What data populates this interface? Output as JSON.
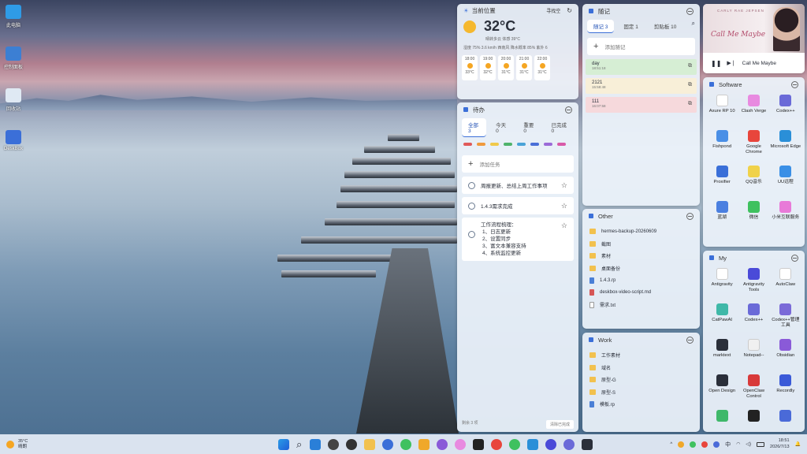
{
  "desktop": {
    "icons": [
      {
        "label": "此电脑",
        "color": "#2f9be6"
      },
      {
        "label": "控制面板",
        "color": "#3c7fd3"
      },
      {
        "label": "回收站",
        "color": "#dfe9f3"
      },
      {
        "label": "DeskBox",
        "color": "#3b6fd8"
      }
    ]
  },
  "weather": {
    "location": "当前位置",
    "refresh_label": "寻找空",
    "temp": "32°C",
    "desc": "晴转多云 体感 39°C",
    "details": "湿度 75%  3.6 km/h 西南风  降水概率 85%  紫外 6",
    "hours": [
      {
        "time": "18:00",
        "temp": "33°C"
      },
      {
        "time": "19:00",
        "temp": "32°C"
      },
      {
        "time": "20:00",
        "temp": "31°C"
      },
      {
        "time": "21:00",
        "temp": "31°C"
      },
      {
        "time": "22:00",
        "temp": "31°C"
      }
    ]
  },
  "todo": {
    "title": "待办",
    "tabs": [
      "全部 3",
      "今天 0",
      "重要 0",
      "已完成 0"
    ],
    "add_placeholder": "添加任务",
    "colors": [
      "#e05a5a",
      "#f09a3e",
      "#f0c94a",
      "#4fb36b",
      "#4aa3d8",
      "#4a6fd8",
      "#9b6ad8",
      "#d85aa8"
    ],
    "items": [
      "周报更新、总结上周工作事项",
      "1.4.3需求完成"
    ],
    "multi": [
      "工作流程梳理：",
      "1、日志更新",
      "2、设置同步",
      "3、富文本兼容支持",
      "4、系统监控更新"
    ],
    "footer_left": "剩余 3 项",
    "footer_right": "清除已完成"
  },
  "notes": {
    "title": "随记",
    "tabs": [
      "随记 3",
      "固定 1",
      "剪贴板 10"
    ],
    "add_placeholder": "添加随记",
    "items": [
      {
        "text": "day",
        "time": "18:51:18",
        "bg": "#d6eed4"
      },
      {
        "text": "2121",
        "time": "15:58:48",
        "bg": "#f8efd8"
      },
      {
        "text": "111",
        "time": "16:07:58",
        "bg": "#f6d9dc"
      }
    ]
  },
  "other": {
    "title": "Other",
    "items": [
      {
        "name": "hermes-backup-20260609",
        "t": "folder"
      },
      {
        "name": "截图",
        "t": "folder"
      },
      {
        "name": "素材",
        "t": "folder"
      },
      {
        "name": "桌面备份",
        "t": "folder"
      },
      {
        "name": "1.4.3.rp",
        "t": "doc"
      },
      {
        "name": "deskbox-video-script.md",
        "t": "red"
      },
      {
        "name": "需求.txt",
        "t": "txt"
      }
    ]
  },
  "work": {
    "title": "Work",
    "items": [
      {
        "name": "工作素材",
        "t": "folder"
      },
      {
        "name": "域名",
        "t": "folder"
      },
      {
        "name": "原型-G",
        "t": "folder"
      },
      {
        "name": "原型-S",
        "t": "folder"
      },
      {
        "name": "模板.rp",
        "t": "doc"
      }
    ]
  },
  "music": {
    "artist": "CARLY RAE JEPSEN",
    "album": "Call Me Maybe",
    "song": "Call Me Maybe"
  },
  "software": {
    "title": "Software",
    "apps": [
      {
        "name": "Axure RP 10",
        "color": "#fff"
      },
      {
        "name": "Clash Verge",
        "color": "#e88ae0"
      },
      {
        "name": "Codex++",
        "color": "#6a6ad8"
      },
      {
        "name": "Fishpond",
        "color": "#4a8fe6"
      },
      {
        "name": "Google Chrome",
        "color": "#e8453c"
      },
      {
        "name": "Microsoft Edge",
        "color": "#2a8fd8"
      },
      {
        "name": "Proxifier",
        "color": "#3a6fd8"
      },
      {
        "name": "QQ音乐",
        "color": "#f0d24a"
      },
      {
        "name": "UU远程",
        "color": "#3a8fe6"
      },
      {
        "name": "蓝湖",
        "color": "#4a7fe0"
      },
      {
        "name": "微信",
        "color": "#3fc15f"
      },
      {
        "name": "小米互联服务",
        "color": "#e87ad8"
      }
    ]
  },
  "my": {
    "title": "My",
    "apps": [
      {
        "name": "Antigravity",
        "color": "#fff"
      },
      {
        "name": "Antigravity Tools",
        "color": "#4a4ad8"
      },
      {
        "name": "AutoClaw",
        "color": "#fff"
      },
      {
        "name": "CatPawAI",
        "color": "#3fb8a8"
      },
      {
        "name": "Codex++",
        "color": "#6a6ad8"
      },
      {
        "name": "Codex++管理工具",
        "color": "#7a6ad8"
      },
      {
        "name": "marktext",
        "color": "#2a2f3a"
      },
      {
        "name": "Notepad--",
        "color": "#f0f0f0"
      },
      {
        "name": "Obsidian",
        "color": "#8a5ad8"
      },
      {
        "name": "Open Design",
        "color": "#2a2f3a"
      },
      {
        "name": "OpenClaw Control",
        "color": "#d83a3a"
      },
      {
        "name": "Recordly",
        "color": "#3a5ad8"
      },
      {
        "name": "",
        "color": "#3fb86a"
      },
      {
        "name": "",
        "color": "#222"
      },
      {
        "name": "",
        "color": "#4a6ad8"
      }
    ]
  },
  "taskbar": {
    "temp": "35°C",
    "weather": "晴朗",
    "time": "18:51",
    "date": "2026/7/13",
    "ime": "中",
    "apps": [
      "#2a7fd8",
      "#444",
      "#333",
      "#f2c14e",
      "#3b6fd8",
      "#3fc15f",
      "#f0a82a",
      "#8a5ad8",
      "#e88ae0",
      "#222",
      "#e8453c",
      "#3fc15f",
      "#2a8fd8",
      "#4a4ad8",
      "#6a6ad8",
      "#2a2f3a"
    ]
  }
}
